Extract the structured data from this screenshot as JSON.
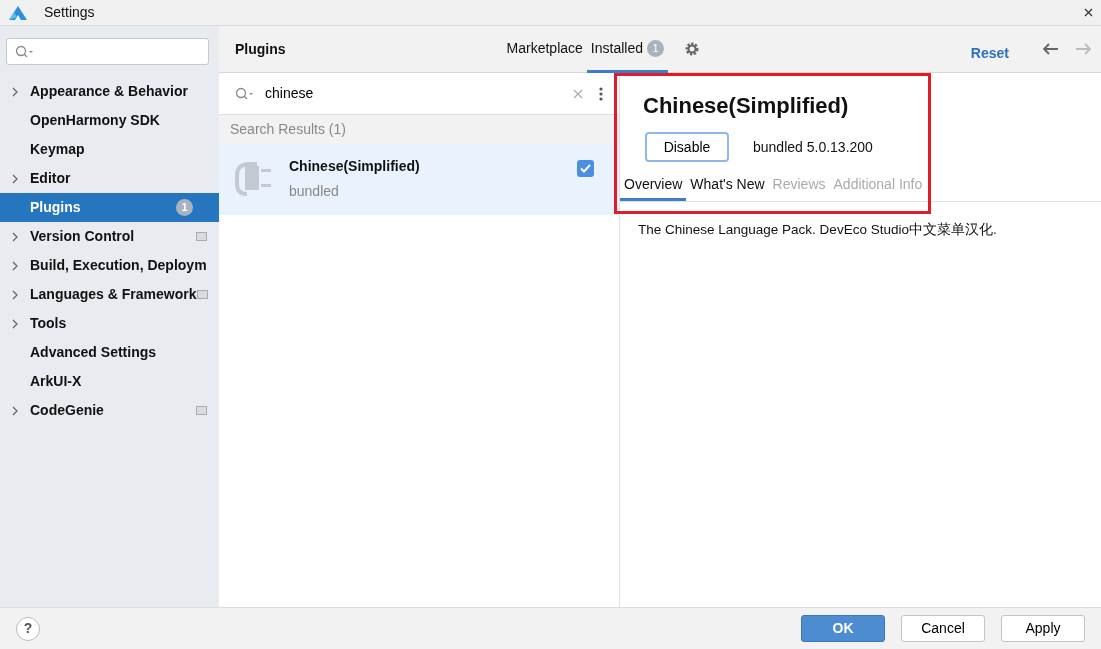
{
  "window": {
    "title": "Settings"
  },
  "sidebar": {
    "items": [
      {
        "label": "Appearance & Behavior",
        "expandable": true,
        "selected": false,
        "trailing_icon": false
      },
      {
        "label": "OpenHarmony SDK",
        "expandable": false,
        "selected": false,
        "trailing_icon": false
      },
      {
        "label": "Keymap",
        "expandable": false,
        "selected": false,
        "trailing_icon": false
      },
      {
        "label": "Editor",
        "expandable": true,
        "selected": false,
        "trailing_icon": false
      },
      {
        "label": "Plugins",
        "expandable": false,
        "selected": true,
        "badge": "1",
        "trailing_icon": false
      },
      {
        "label": "Version Control",
        "expandable": true,
        "selected": false,
        "trailing_icon": true
      },
      {
        "label": "Build, Execution, Deploym",
        "expandable": true,
        "selected": false,
        "trailing_icon": false
      },
      {
        "label": "Languages & Framework",
        "expandable": true,
        "selected": false,
        "trailing_icon": true
      },
      {
        "label": "Tools",
        "expandable": true,
        "selected": false,
        "trailing_icon": false
      },
      {
        "label": "Advanced Settings",
        "expandable": false,
        "selected": false,
        "trailing_icon": false
      },
      {
        "label": "ArkUI-X",
        "expandable": false,
        "selected": false,
        "trailing_icon": false
      },
      {
        "label": "CodeGenie",
        "expandable": true,
        "selected": false,
        "trailing_icon": true
      }
    ]
  },
  "header": {
    "title": "Plugins",
    "tabs": [
      {
        "label": "Marketplace",
        "selected": false
      },
      {
        "label": "Installed",
        "selected": true,
        "badge": "1"
      }
    ],
    "reset": "Reset"
  },
  "search": {
    "value": "chinese"
  },
  "results": {
    "heading": "Search Results (1)",
    "plugins": [
      {
        "name": "Chinese(Simplified)",
        "source": "bundled",
        "selected": true,
        "checked": true
      }
    ]
  },
  "detail": {
    "title": "Chinese(Simplified)",
    "button": "Disable",
    "version": "bundled 5.0.13.200",
    "tabs": [
      {
        "label": "Overview",
        "selected": true,
        "disabled": false
      },
      {
        "label": "What's New",
        "selected": false,
        "disabled": false
      },
      {
        "label": "Reviews",
        "selected": false,
        "disabled": true
      },
      {
        "label": "Additional Info",
        "selected": false,
        "disabled": true
      }
    ],
    "description": "The Chinese Language Pack. DevEco Studio中文菜单汉化."
  },
  "footer": {
    "help": "?",
    "buttons": [
      {
        "label": "OK",
        "primary": true
      },
      {
        "label": "Cancel",
        "primary": false
      },
      {
        "label": "Apply",
        "primary": false
      }
    ]
  }
}
